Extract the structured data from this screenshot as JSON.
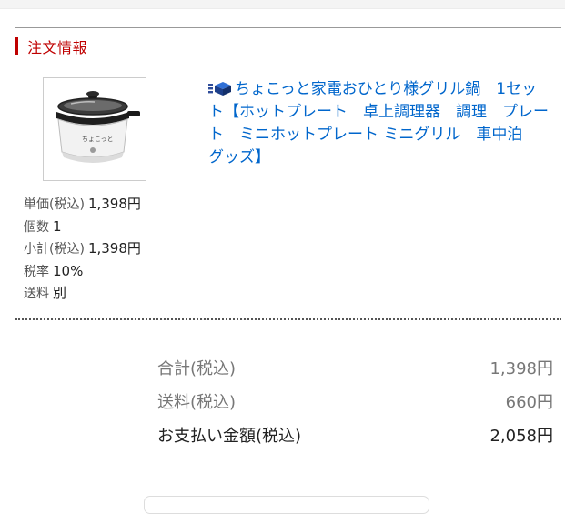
{
  "section": {
    "heading": "注文情報"
  },
  "product": {
    "image_icon": "electric-grill-pot-image",
    "title": "ちょこっと家電おひとり様グリル鍋　1セット【ホットプレート　卓上調理器　調理　プレート　ミニホットプレート ミニグリル　車中泊　グッズ】",
    "title_icon": "shop-icon",
    "pot_label": "ちょこっと",
    "details": [
      {
        "label": "単価(税込)",
        "value": "1,398円"
      },
      {
        "label": "個数",
        "value": "1"
      },
      {
        "label": "小計(税込)",
        "value": "1,398円"
      },
      {
        "label": "税率",
        "value": "10%"
      },
      {
        "label": "送料",
        "value": "別"
      }
    ]
  },
  "summary": {
    "rows": [
      {
        "label": "合計(税込)",
        "value": "1,398円"
      },
      {
        "label": "送料(税込)",
        "value": "660円"
      },
      {
        "label": "お支払い金額(税込)",
        "value": "2,058円"
      }
    ]
  },
  "colors": {
    "accent_red": "#bf0000",
    "link_blue": "#0066cc"
  }
}
